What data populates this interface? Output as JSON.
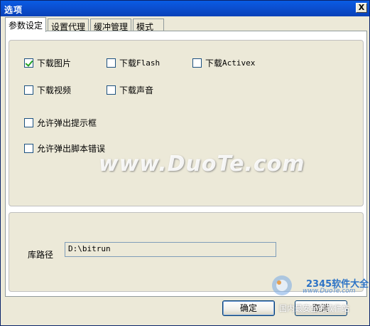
{
  "window": {
    "title": "选项",
    "close_label": "X"
  },
  "tabs": [
    {
      "label": "参数设定",
      "active": true
    },
    {
      "label": "设置代理",
      "active": false
    },
    {
      "label": "缓冲管理",
      "active": false
    },
    {
      "label": "模式",
      "active": false
    }
  ],
  "options": {
    "download_images": {
      "label": "下载图片",
      "checked": true
    },
    "download_flash": {
      "prefix": "下载",
      "mono": "Flash",
      "checked": false
    },
    "download_activex": {
      "prefix": "下载",
      "mono": "Activex",
      "checked": false
    },
    "download_video": {
      "label": "下载视频",
      "checked": false
    },
    "download_sound": {
      "label": "下载声音",
      "checked": false
    },
    "allow_popup_tips": {
      "label": "允许弹出提示框",
      "checked": false
    },
    "allow_script_errors": {
      "label": "允许弹出脚本错误",
      "checked": false
    }
  },
  "library": {
    "label": "库路径",
    "value": "D:\\bitrun"
  },
  "buttons": {
    "ok": "确定",
    "cancel": "取消"
  },
  "watermark": {
    "text": "www.DuoTe.com"
  },
  "logo": {
    "brand": "2345软件大全",
    "url": "www.DuoTe.com",
    "tagline": "国内最安全的软件站"
  },
  "colors": {
    "titlebar": "#0a5ce4",
    "check_mark": "#21a121",
    "window_bg": "#ece9d8"
  }
}
